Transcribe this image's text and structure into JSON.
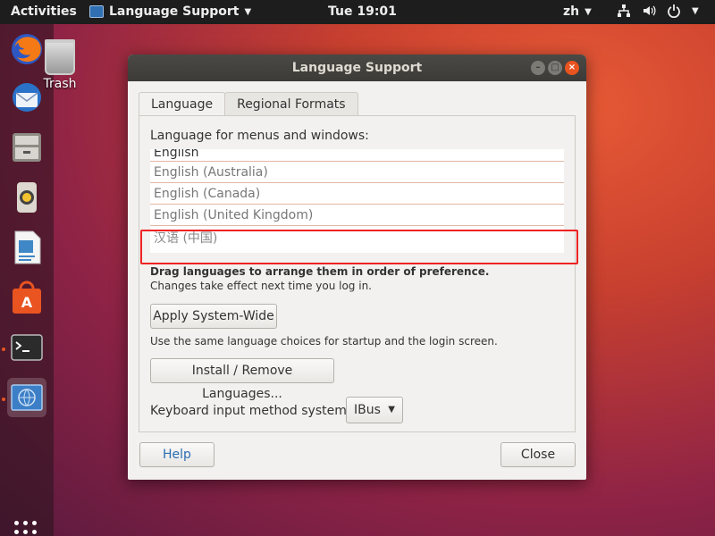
{
  "topbar": {
    "activities": "Activities",
    "app_name": "Language Support",
    "clock": "Tue 19:01",
    "input_lang": "zh"
  },
  "desktop": {
    "trash_label": "Trash"
  },
  "dock": {
    "items": [
      "firefox",
      "thunderbird",
      "files",
      "rhythmbox",
      "libreoffice-writer",
      "ubuntu-software",
      "terminal",
      "language-support"
    ]
  },
  "dialog": {
    "title": "Language Support",
    "tabs": [
      "Language",
      "Regional Formats"
    ],
    "selected_tab": "Language",
    "list_label": "Language for menus and windows:",
    "languages": [
      "English",
      "English (Australia)",
      "English (Canada)",
      "English (United Kingdom)",
      "汉语 (中国)"
    ],
    "drag_hint": "Drag languages to arrange them in order of preference.",
    "effect_note": "Changes take effect next time you log in.",
    "apply_button": "Apply System-Wide",
    "same_choices_note": "Use the same language choices for startup and the login screen.",
    "install_button": "Install / Remove Languages...",
    "keyboard_label": "Keyboard input method system:",
    "keyboard_value": "IBus",
    "help_button": "Help",
    "close_button": "Close"
  },
  "colors": {
    "accent": "#e95420",
    "highlight_box": "#ee2222"
  }
}
